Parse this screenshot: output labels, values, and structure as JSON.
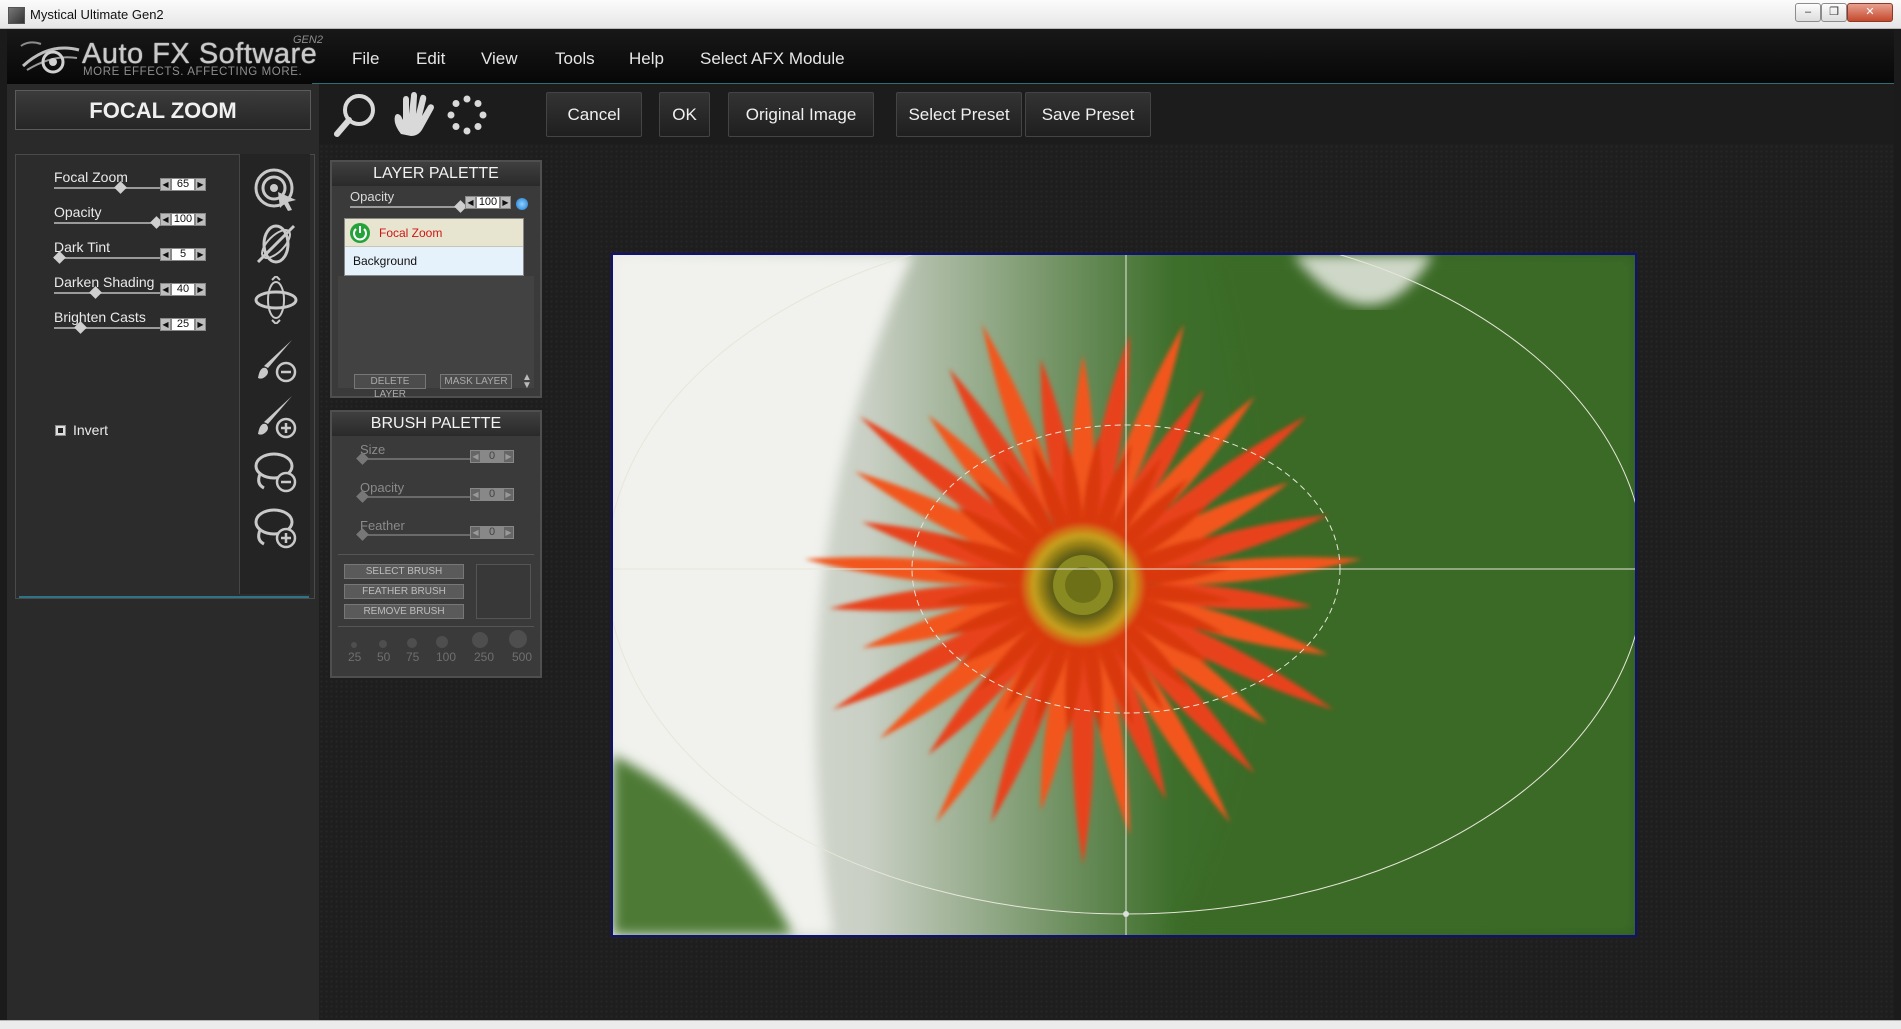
{
  "window": {
    "title": "Mystical Ultimate Gen2",
    "controls": [
      "minimize-icon",
      "restore-icon",
      "close-icon"
    ]
  },
  "logo": {
    "brand": "Auto FX Software",
    "tagline": "MORE EFFECTS. AFFECTING MORE.",
    "gen": "GEN2"
  },
  "menu": {
    "items": [
      "File",
      "Edit",
      "View",
      "Tools",
      "Help",
      "Select AFX Module"
    ]
  },
  "effect": {
    "title": "FOCAL ZOOM",
    "sliders": [
      {
        "label": "Focal Zoom",
        "value": "65",
        "fraction": 0.65
      },
      {
        "label": "Opacity",
        "value": "100",
        "fraction": 1.0
      },
      {
        "label": "Dark Tint",
        "value": "5",
        "fraction": 0.05
      },
      {
        "label": "Darken Shading",
        "value": "40",
        "fraction": 0.4
      },
      {
        "label": "Brighten Casts",
        "value": "25",
        "fraction": 0.25
      }
    ],
    "invert_label": "Invert",
    "invert_checked": true,
    "tools": [
      "focal-target-icon",
      "no-selection-icon",
      "orbit-icon",
      "brush-remove-icon",
      "brush-add-icon",
      "lasso-remove-icon",
      "lasso-add-icon"
    ]
  },
  "toolbar": {
    "view_tools": [
      "zoom-icon",
      "hand-icon",
      "spinner-icon"
    ],
    "cancel": "Cancel",
    "ok": "OK",
    "original": "Original Image",
    "select_preset": "Select Preset",
    "save_preset": "Save Preset"
  },
  "layer_palette": {
    "title": "LAYER PALETTE",
    "opacity_label": "Opacity",
    "opacity_value": "100",
    "opacity_fraction": 1.0,
    "layers": [
      {
        "name": "Focal Zoom",
        "visible": true,
        "selected": true
      },
      {
        "name": "Background",
        "visible": false,
        "selected": false
      }
    ],
    "delete_label": "DELETE LAYER",
    "mask_label": "MASK LAYER"
  },
  "brush_palette": {
    "title": "BRUSH PALETTE",
    "sliders": [
      {
        "label": "Size",
        "value": "0"
      },
      {
        "label": "Opacity",
        "value": "0"
      },
      {
        "label": "Feather",
        "value": "0"
      }
    ],
    "buttons": [
      "SELECT BRUSH",
      "FEATHER BRUSH",
      "REMOVE BRUSH"
    ],
    "sizes": [
      "25",
      "50",
      "75",
      "100",
      "250",
      "500"
    ]
  },
  "colors": {
    "accent_cyan": "#2e6c7a",
    "image_border": "#10107a",
    "focal_layer_text": "#d01515"
  }
}
